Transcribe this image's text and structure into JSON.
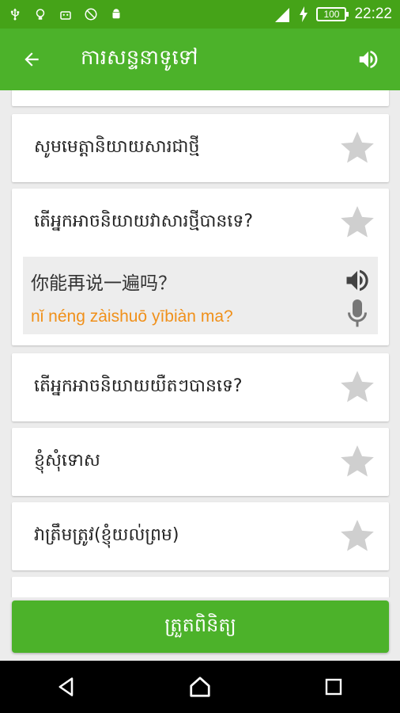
{
  "status_bar": {
    "time": "22:22",
    "battery": "100",
    "icons": [
      "usb-icon",
      "bulb-icon",
      "android-debug-icon",
      "no-sim-icon",
      "android-icon",
      "signal-icon",
      "charging-icon"
    ]
  },
  "app_bar": {
    "title": "ការសន្ទនាទូទៅ",
    "back_icon": "arrow-back-icon",
    "speaker_icon": "volume-icon"
  },
  "phrases": [
    {
      "text": "សូមមេត្តានិយាយសារជាថ្មី",
      "starred": false
    },
    {
      "text": "តើអ្នកអាចនិយាយវាសារថ្មីបានទេ?",
      "starred": false,
      "expanded": true,
      "chinese": "你能再说一遍吗？",
      "pinyin": "nǐ néng zàishuō yībiàn ma?"
    },
    {
      "text": "តើអ្នកអាចនិយាយយឺតៗបានទេ?",
      "starred": false
    },
    {
      "text": "ខ្ញុំសុំទោស",
      "starred": false
    },
    {
      "text": "វាត្រឹមត្រូវ(ខ្ញុំយល់ព្រម)",
      "starred": false
    }
  ],
  "quiz_button": {
    "label": "ត្រួតពិនិត្យ"
  },
  "colors": {
    "status": "#45a318",
    "primary": "#4cb22a",
    "pinyin": "#f0901a",
    "star": "#cfcfcf"
  }
}
